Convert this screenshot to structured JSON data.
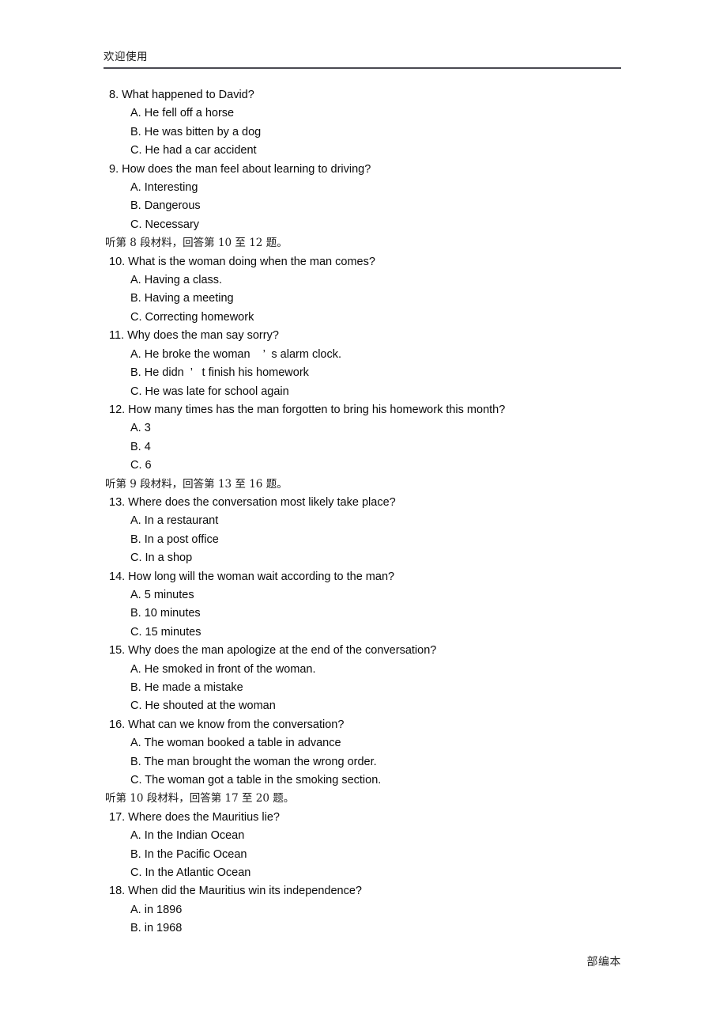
{
  "header": {
    "title": "欢迎使用"
  },
  "footer": {
    "text": "部编本"
  },
  "blocks": [
    {
      "kind": "question",
      "text": "8. What happened to David?"
    },
    {
      "kind": "option",
      "text": "A. He fell off a horse"
    },
    {
      "kind": "option",
      "text": "B. He was bitten by a dog"
    },
    {
      "kind": "option",
      "text": "C. He had a car accident"
    },
    {
      "kind": "question",
      "text": "9. How does the man feel about learning to driving?"
    },
    {
      "kind": "option",
      "text": "A. Interesting"
    },
    {
      "kind": "option",
      "text": "B. Dangerous"
    },
    {
      "kind": "option",
      "text": "C. Necessary"
    },
    {
      "kind": "chinese",
      "text": "听第 8 段材料，回答第 10 至 12 题。"
    },
    {
      "kind": "question",
      "text": "10. What is the woman doing when the man comes?"
    },
    {
      "kind": "option",
      "text": "A. Having a class."
    },
    {
      "kind": "option",
      "text": "B. Having a meeting"
    },
    {
      "kind": "option",
      "text": "C. Correcting homework"
    },
    {
      "kind": "question",
      "text": "11. Why does the man say sorry?"
    },
    {
      "kind": "option",
      "text": "A. He broke the woman    ’  s alarm clock."
    },
    {
      "kind": "option",
      "text": "B. He didn  ’   t finish his homework"
    },
    {
      "kind": "option",
      "text": "C. He was late for school again"
    },
    {
      "kind": "question",
      "text": "12. How many times has the man forgotten to bring his homework this month?"
    },
    {
      "kind": "option",
      "text": "A. 3"
    },
    {
      "kind": "option",
      "text": "B. 4"
    },
    {
      "kind": "option",
      "text": "C. 6"
    },
    {
      "kind": "chinese",
      "text": "听第 9 段材料，回答第 13 至 16 题。"
    },
    {
      "kind": "question",
      "text": "13. Where does the conversation most likely take place?"
    },
    {
      "kind": "option",
      "text": "A. In a restaurant"
    },
    {
      "kind": "option",
      "text": "B. In a post office"
    },
    {
      "kind": "option",
      "text": "C. In a shop"
    },
    {
      "kind": "question",
      "text": "14. How long will the woman wait according to the man?"
    },
    {
      "kind": "option",
      "text": "A. 5 minutes"
    },
    {
      "kind": "option",
      "text": "B. 10 minutes"
    },
    {
      "kind": "option",
      "text": "C. 15 minutes"
    },
    {
      "kind": "question",
      "text": "15. Why does the man apologize at the end of the conversation?"
    },
    {
      "kind": "option",
      "text": "A. He smoked in front of the woman."
    },
    {
      "kind": "option",
      "text": "B. He made a mistake"
    },
    {
      "kind": "option",
      "text": "C. He shouted at the woman"
    },
    {
      "kind": "question",
      "text": "16. What can we know from the conversation?"
    },
    {
      "kind": "option",
      "text": "A. The woman booked a table in advance"
    },
    {
      "kind": "option",
      "text": "B. The man brought the woman the wrong order."
    },
    {
      "kind": "option",
      "text": "C. The woman got a table in the smoking section."
    },
    {
      "kind": "chinese",
      "text": "听第 10 段材料，回答第 17 至 20 题。"
    },
    {
      "kind": "question",
      "text": "17. Where does the Mauritius lie?"
    },
    {
      "kind": "option",
      "text": "A. In the Indian Ocean"
    },
    {
      "kind": "option",
      "text": "B. In the Pacific Ocean"
    },
    {
      "kind": "option",
      "text": "C. In the Atlantic Ocean"
    },
    {
      "kind": "question",
      "text": "18. When did the Mauritius win its independence?"
    },
    {
      "kind": "option",
      "text": "A. in 1896"
    },
    {
      "kind": "option",
      "text": "B. in 1968"
    }
  ]
}
